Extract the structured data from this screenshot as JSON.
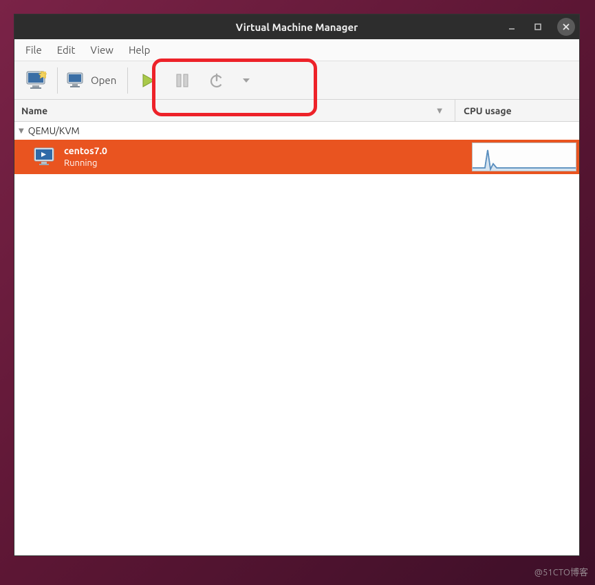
{
  "window": {
    "title": "Virtual Machine Manager"
  },
  "menubar": {
    "items": [
      "File",
      "Edit",
      "View",
      "Help"
    ]
  },
  "toolbar": {
    "open_label": "Open"
  },
  "columns": {
    "name": "Name",
    "cpu": "CPU usage"
  },
  "connections": [
    {
      "label": "QEMU/KVM",
      "expanded": true,
      "vms": [
        {
          "name": "centos7.0",
          "status": "Running"
        }
      ]
    }
  ],
  "watermark": "@51CTO博客"
}
